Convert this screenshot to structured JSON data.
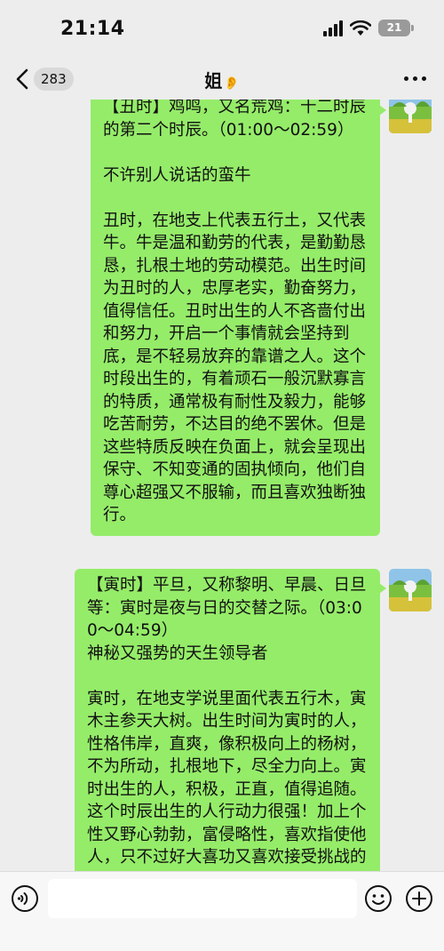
{
  "status_bar": {
    "time": "21:14",
    "battery": "21"
  },
  "nav": {
    "unread_count": "283",
    "title": "姐",
    "title_mark": "👂"
  },
  "messages": [
    {
      "text": "【丑时】鸡鸣，又名荒鸡：十二时辰的第二个时辰。（01:00～02:59）\n\n不许别人说话的蛮牛\n\n丑时，在地支上代表五行土，又代表牛。牛是温和勤劳的代表，是勤勤恳恳，扎根土地的劳动模范。出生时间为丑时的人，忠厚老实，勤奋努力，值得信任。丑时出生的人不吝啬付出和努力，开启一个事情就会坚持到底，是不轻易放弃的靠谱之人。这个时段出生的，有着顽石一般沉默寡言的特质，通常极有耐性及毅力，能够吃苦耐劳，不达目的绝不罢休。但是这些特质反映在负面上，就会呈现出保守、不知变通的固执倾向，他们自尊心超强又不服输，而且喜欢独断独行。"
    },
    {
      "text": "【寅时】平旦，又称黎明、早晨、日旦等：寅时是夜与日的交替之际。（03:00～04:59）\n神秘又强势的天生领导者\n\n寅时，在地支学说里面代表五行木，寅木主参天大树。出生时间为寅时的人，性格伟岸，直爽，像积极向上的杨树，不为所动，扎根地下，尽全力向上。寅时出生的人，积极，正直，值得追随。这个时辰出生的人行动力很强！加上个性又野心勃勃，富侵略性，喜欢指使他人，只不过好大喜功又喜欢接受挑战的他"
    }
  ],
  "input": {
    "placeholder": ""
  },
  "colors": {
    "bubble": "#95ec69",
    "background": "#ededed"
  }
}
